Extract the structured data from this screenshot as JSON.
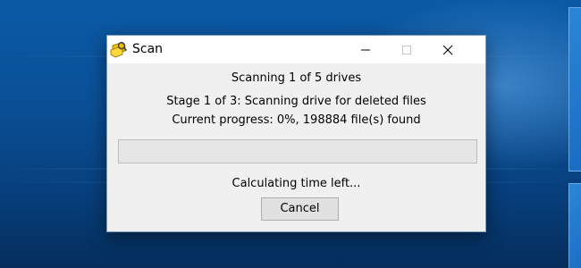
{
  "dialog": {
    "title": "Scan",
    "icon": "scan-app-icon",
    "controls": [
      "minimize-icon",
      "maximize-icon",
      "close-icon"
    ]
  },
  "status": {
    "drives": "Scanning 1 of 5 drives",
    "stage": "Stage 1 of 3: Scanning drive for deleted files",
    "progress_text": "Current progress: 0%, 198884 file(s) found",
    "time_left": "Calculating time left..."
  },
  "progress": {
    "percent": 0,
    "fill_color": "#06b025"
  },
  "buttons": {
    "cancel": "Cancel"
  }
}
